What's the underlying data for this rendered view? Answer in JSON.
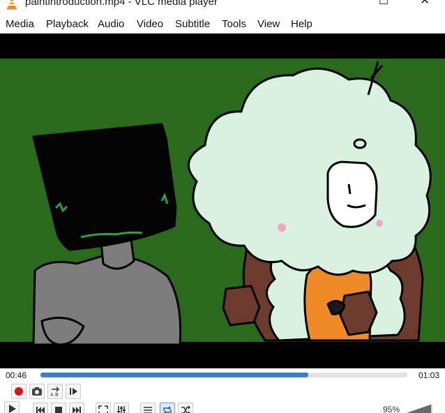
{
  "window": {
    "title": "paintintroduction.mp4 - VLC media player",
    "minimize_glyph": "─",
    "maximize_glyph": "☐",
    "close_glyph": "✕"
  },
  "menu": [
    "Media",
    "Playback",
    "Audio",
    "Video",
    "Subtitle",
    "Tools",
    "View",
    "Help"
  ],
  "seek": {
    "elapsed": "00:46",
    "total": "01:03",
    "progress": 0.73
  },
  "controls": {
    "volume": "95%",
    "volume_level": 0.95,
    "loop_active": true,
    "loop_ab_label": "A B"
  },
  "colors": {
    "accent": "#3a7fd0",
    "record": "#e0101a",
    "video_background": "#2a6a1c"
  },
  "icons": [
    "vlc-cone-icon",
    "record-icon",
    "snapshot-icon",
    "loop-ab-icon",
    "frame-step-icon",
    "play-icon",
    "previous-icon",
    "stop-icon",
    "next-icon",
    "fullscreen-icon",
    "extended-settings-icon",
    "playlist-icon",
    "loop-icon",
    "shuffle-icon",
    "volume-icon"
  ]
}
